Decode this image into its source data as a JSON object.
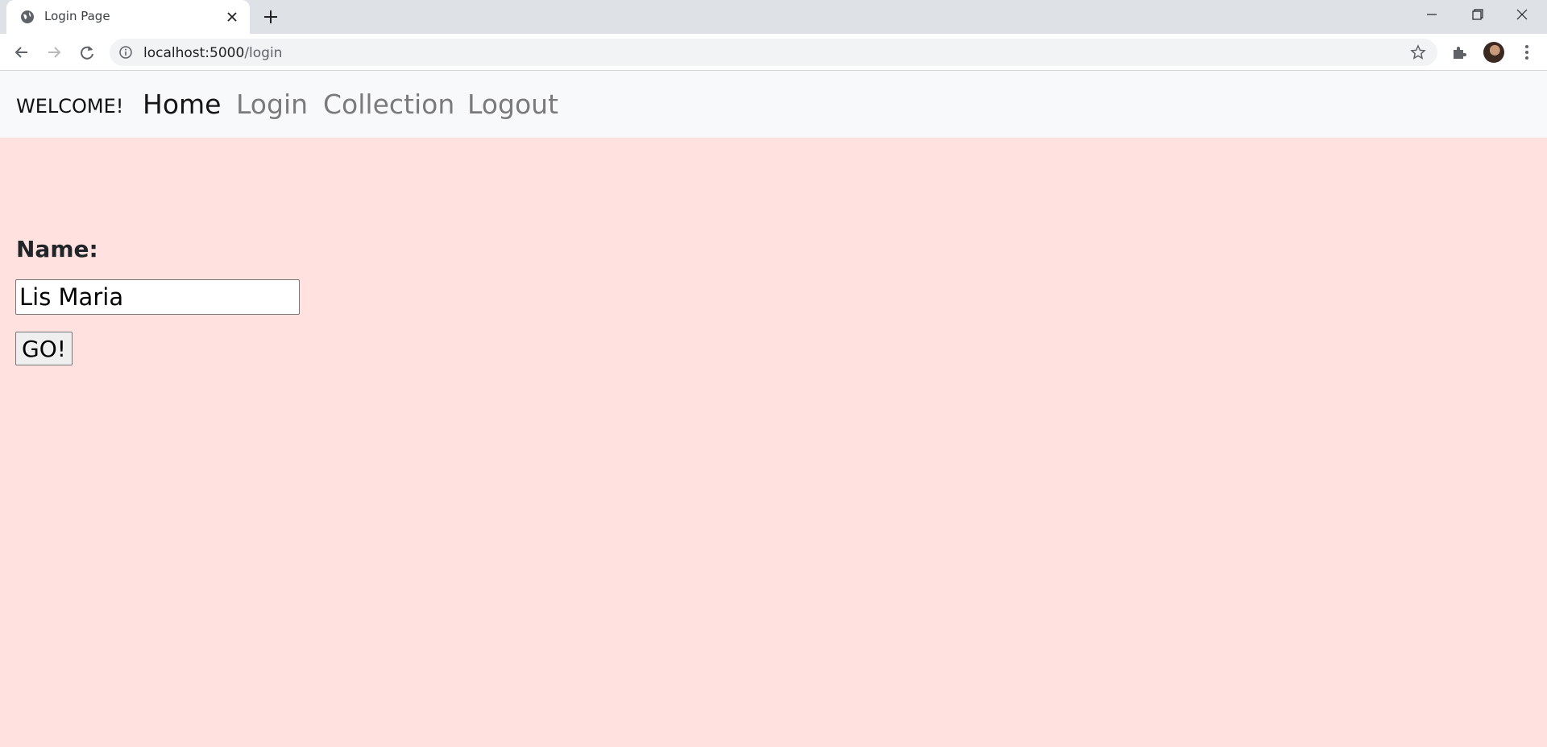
{
  "browser": {
    "tab": {
      "title": "Login Page",
      "favicon": "globe-icon"
    },
    "window_controls": {
      "minimize": "minimize-icon",
      "maximize": "restore-icon",
      "close": "close-icon"
    },
    "address": {
      "host": "localhost:5000",
      "path": "/login"
    }
  },
  "navbar": {
    "brand": "WELCOME!",
    "links": [
      {
        "label": "Home",
        "active": true
      },
      {
        "label": "Login",
        "active": false
      },
      {
        "label": "Collection",
        "active": false
      },
      {
        "label": "Logout",
        "active": false
      }
    ]
  },
  "form": {
    "label": "Name:",
    "input_value": "Lis Maria",
    "button_label": "GO!"
  },
  "colors": {
    "page_background": "#ffe1df",
    "navbar_background": "#f8f9fa",
    "active_link": "#151515",
    "inactive_link": "#7a7a7a"
  }
}
